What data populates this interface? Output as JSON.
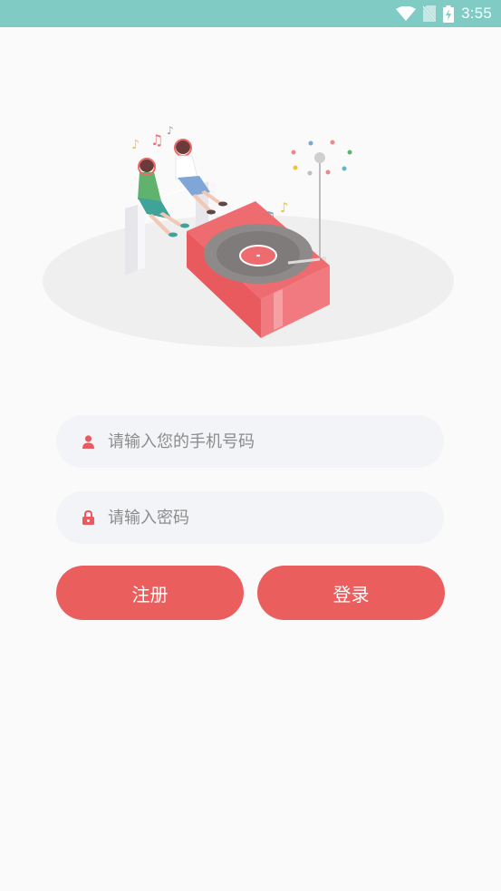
{
  "status_bar": {
    "time": "3:55",
    "background": "#80cbc4",
    "icons": [
      "wifi-icon",
      "no-sim-icon",
      "battery-charging-icon"
    ]
  },
  "illustration": {
    "description_icon": "record-player-illustration-icon"
  },
  "form": {
    "phone": {
      "placeholder": "请输入您的手机号码",
      "icon": "user-icon",
      "value": ""
    },
    "password": {
      "placeholder": "请输入密码",
      "icon": "lock-icon",
      "value": ""
    }
  },
  "buttons": {
    "register_label": "注册",
    "login_label": "登录",
    "color": "#eb5e5e"
  }
}
